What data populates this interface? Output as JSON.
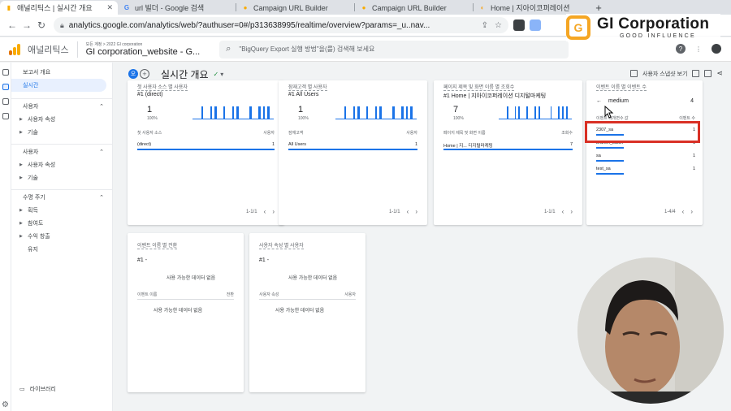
{
  "browser": {
    "tabs": [
      {
        "title": "애널리틱스 | 실시간 개요",
        "active": true,
        "favicon": "ga-icon"
      },
      {
        "title": "url 빌더 - Google 검색",
        "active": false,
        "favicon": "google-icon"
      },
      {
        "title": "Campaign URL Builder",
        "active": false,
        "favicon": "campaign-icon"
      },
      {
        "title": "Campaign URL Builder",
        "active": false,
        "favicon": "campaign-icon"
      },
      {
        "title": "Home | 지아이코퍼레이션",
        "active": false,
        "favicon": "home-icon"
      }
    ],
    "close_glyph": "✕",
    "new_tab": "+",
    "url": "analytics.google.com/analytics/web/?authuser=0#/p313638995/realtime/overview?params=_u..nav..."
  },
  "watermark": {
    "text": "GI Corporation",
    "subtitle": "GOOD INFLUENCE",
    "mark": "G"
  },
  "ga": {
    "brand": "애널리틱스",
    "crumb": "모든 계정 > 2022 GI corporation",
    "property": "GI corporation_website - G...",
    "search_placeholder": "\"BigQuery Export 실행 방법\"을(를) 검색해 보세요",
    "help_glyph": "?",
    "menu_glyph": "⋮"
  },
  "sidebar": {
    "overview": "보고서 개요",
    "realtime": "실시간",
    "sections": [
      {
        "title": "사용자",
        "items": [
          "사용자 속성",
          "기술"
        ]
      },
      {
        "title": "사용자",
        "items": [
          "사용자 속성",
          "기술"
        ]
      },
      {
        "title": "수명 주기",
        "items": [
          "획득",
          "참여도",
          "수익 창출",
          "유지"
        ]
      }
    ],
    "library": "라이브러리"
  },
  "content": {
    "badge": "오",
    "page_title": "실시간 개요",
    "status": "✓",
    "compare_label": "사용자 스냅샷 보기"
  },
  "cards": {
    "source": {
      "title": "첫 사용자 소스 별 사용자",
      "rank": "#1 (direct)",
      "value": "1",
      "pct": "100%",
      "col1": "첫 사용자 소스",
      "col2": "사용자",
      "row_label": "(direct)",
      "row_value": "1",
      "pager": "1-1/1"
    },
    "audience": {
      "title": "잠재고객 별 사용자",
      "rank": "#1 All Users",
      "value": "1",
      "pct": "100%",
      "col1": "잠재고객",
      "col2": "사용자",
      "row_label": "All Users",
      "row_value": "1",
      "pager": "1-1/1"
    },
    "page": {
      "title": "페이지 제목 및 화면 이름 별 조회수",
      "rank": "#1 Home | 지아이코퍼레이션 디지털마케팅",
      "value": "7",
      "pct": "100%",
      "col1": "페이지 제목 및 화면 이름",
      "col2": "조회수",
      "row_label": "Home | 지... 디지털마케팅",
      "row_value": "7",
      "pager": "1-1/1"
    },
    "event": {
      "title": "이벤트 이름 별 이벤트 수",
      "dimension": "medium",
      "dimension_count": "4",
      "header_left": "이벤트 매개변수 값",
      "header_right": "이벤트 수",
      "rows": [
        {
          "label": "2307_sa",
          "value": "1"
        },
        {
          "label": "branch_batch",
          "value": "1"
        },
        {
          "label": "sa",
          "value": "1"
        },
        {
          "label": "test_sa",
          "value": "1"
        }
      ],
      "pager": "1-4/4"
    },
    "conversion": {
      "title": "이벤트 이름 별 전환",
      "rank": "#1 -",
      "nodata": "사용 가능한 데이터 없음",
      "col1": "이벤트 이름",
      "col2": "전환",
      "nodata2": "사용 가능한 데이터 없음"
    },
    "userprop": {
      "title": "사용자 속성 별 사용자",
      "rank": "#1 -",
      "nodata": "사용 가능한 데이터 없음",
      "col1": "사용자 속성",
      "col2": "사용자",
      "nodata2": "사용 가능한 데이터 없음"
    }
  },
  "sparkline": {
    "source": [
      0,
      0,
      1,
      0,
      1,
      1,
      0,
      1,
      0,
      1,
      1,
      0,
      0,
      1,
      0,
      1,
      1,
      1,
      0
    ],
    "audience": [
      0,
      0,
      1,
      0,
      1,
      1,
      0,
      1,
      0,
      1,
      1,
      0,
      0,
      1,
      0,
      1,
      1,
      1,
      0
    ],
    "page": [
      0,
      0,
      1,
      0,
      1,
      1,
      0,
      1,
      0,
      1,
      1,
      0,
      0,
      1,
      0,
      1,
      1,
      1,
      0
    ]
  },
  "colors": {
    "accent": "#1a73e8",
    "highlight": "#d93025",
    "logo": "#f5a623"
  }
}
